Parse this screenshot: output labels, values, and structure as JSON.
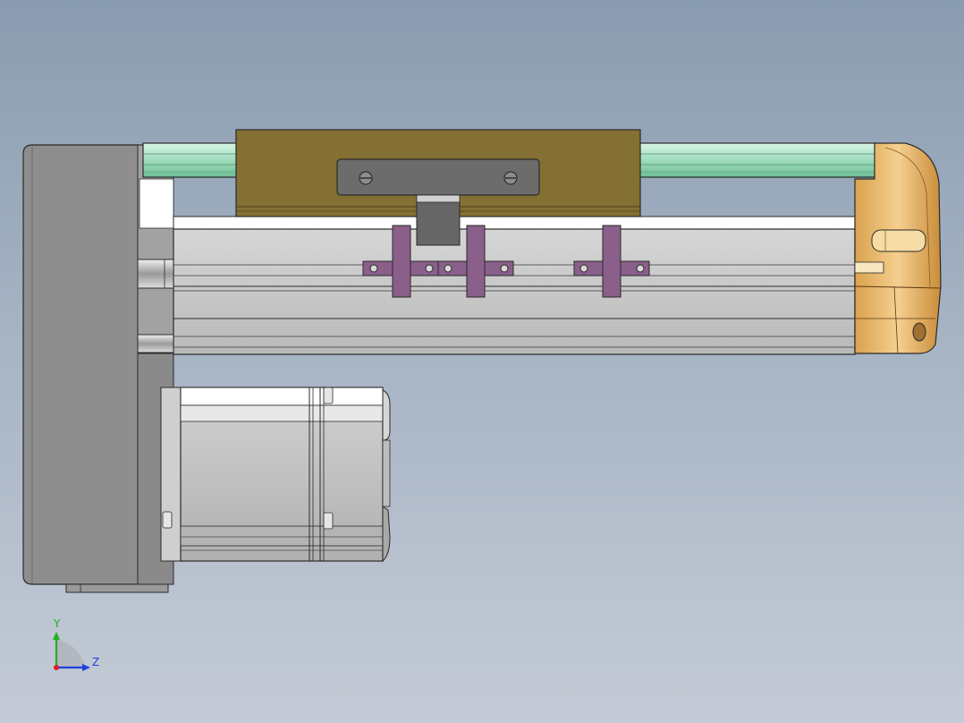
{
  "triad": {
    "y_label": "Y",
    "z_label": "Z",
    "x_color": "#e02020",
    "y_color": "#20b020",
    "z_color": "#2040e0"
  },
  "colors": {
    "background_top": "#8a9cb0",
    "background_bottom": "#c4cbd6",
    "motor_housing": "#8f8f8f",
    "rail": "#a8e0c4",
    "carriage": "#857233",
    "aluminum_profile": "#c8c8c8",
    "end_cap": "#e8bb6e",
    "brackets": "#8a5f8a",
    "plate": "#6a6a6a"
  }
}
